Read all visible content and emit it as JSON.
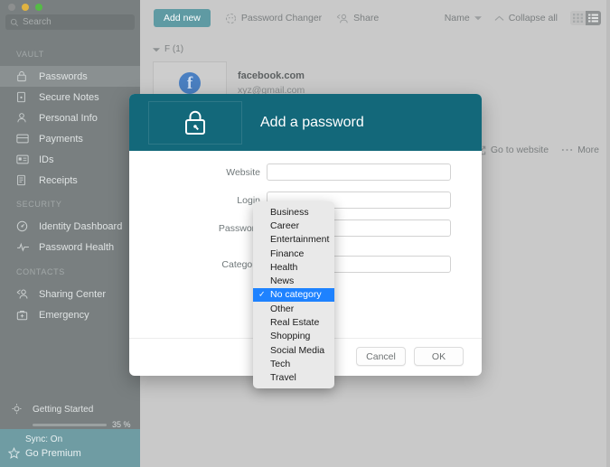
{
  "window": {
    "traffic_lights": [
      "close",
      "minimize",
      "maximize"
    ]
  },
  "sidebar": {
    "search": {
      "placeholder": "Search",
      "value": "",
      "icon": "search-icon"
    },
    "sections": [
      {
        "label": "VAULT",
        "items": [
          {
            "label": "Passwords",
            "icon": "lock-icon",
            "active": true
          },
          {
            "label": "Secure Notes",
            "icon": "note-icon",
            "active": false
          },
          {
            "label": "Personal Info",
            "icon": "person-icon",
            "active": false
          },
          {
            "label": "Payments",
            "icon": "card-icon",
            "active": false
          },
          {
            "label": "IDs",
            "icon": "id-card-icon",
            "active": false
          },
          {
            "label": "Receipts",
            "icon": "receipt-icon",
            "active": false
          }
        ]
      },
      {
        "label": "SECURITY",
        "items": [
          {
            "label": "Identity Dashboard",
            "icon": "dashboard-icon",
            "active": false
          },
          {
            "label": "Password Health",
            "icon": "pulse-icon",
            "active": false
          }
        ]
      },
      {
        "label": "CONTACTS",
        "items": [
          {
            "label": "Sharing Center",
            "icon": "share-person-icon",
            "active": false
          },
          {
            "label": "Emergency",
            "icon": "emergency-kit-icon",
            "active": false
          }
        ]
      }
    ],
    "getting_started": {
      "label": "Getting Started",
      "percent_label": "35 %",
      "percent_value": 35,
      "icon": "lightbulb-icon"
    },
    "footer": {
      "sync_label": "Sync: On",
      "premium_label": "Go Premium",
      "icon": "star-icon",
      "background": "#6f9ca3"
    }
  },
  "toolbar": {
    "add_new_label": "Add new",
    "password_changer_label": "Password Changer",
    "share_label": "Share",
    "sort_label": "Name",
    "collapse_label": "Collapse all",
    "grid_view_icon": "grid-view-icon",
    "list_view_icon": "list-view-icon",
    "accent": "#5f9aa3"
  },
  "list": {
    "group_header": "F (1)",
    "entries": [
      {
        "title": "facebook.com",
        "subtitle": "xyz@gmail.com",
        "icon_letter": "f",
        "icon_name": "facebook-icon"
      }
    ],
    "actions": {
      "go_to_website_label": "Go to website",
      "more_label": "More"
    }
  },
  "modal": {
    "title": "Add a password",
    "header_icon": "lock-shield-icon",
    "header_color": "#13687a",
    "fields": [
      {
        "label": "Website",
        "value": "",
        "placeholder": ""
      },
      {
        "label": "Login",
        "value": "",
        "placeholder": ""
      },
      {
        "label": "Password",
        "value": "",
        "placeholder": ""
      },
      {
        "label": "Category",
        "value": "No category",
        "placeholder": ""
      }
    ],
    "cancel_label": "Cancel",
    "ok_label": "OK"
  },
  "dropdown": {
    "name": "category-dropdown",
    "selected": "No category",
    "selected_highlight": "#1e82ff",
    "check_glyph": "✓",
    "options": [
      "Business",
      "Career",
      "Entertainment",
      "Finance",
      "Health",
      "News",
      "No category",
      "Other",
      "Real Estate",
      "Shopping",
      "Social Media",
      "Tech",
      "Travel"
    ]
  }
}
